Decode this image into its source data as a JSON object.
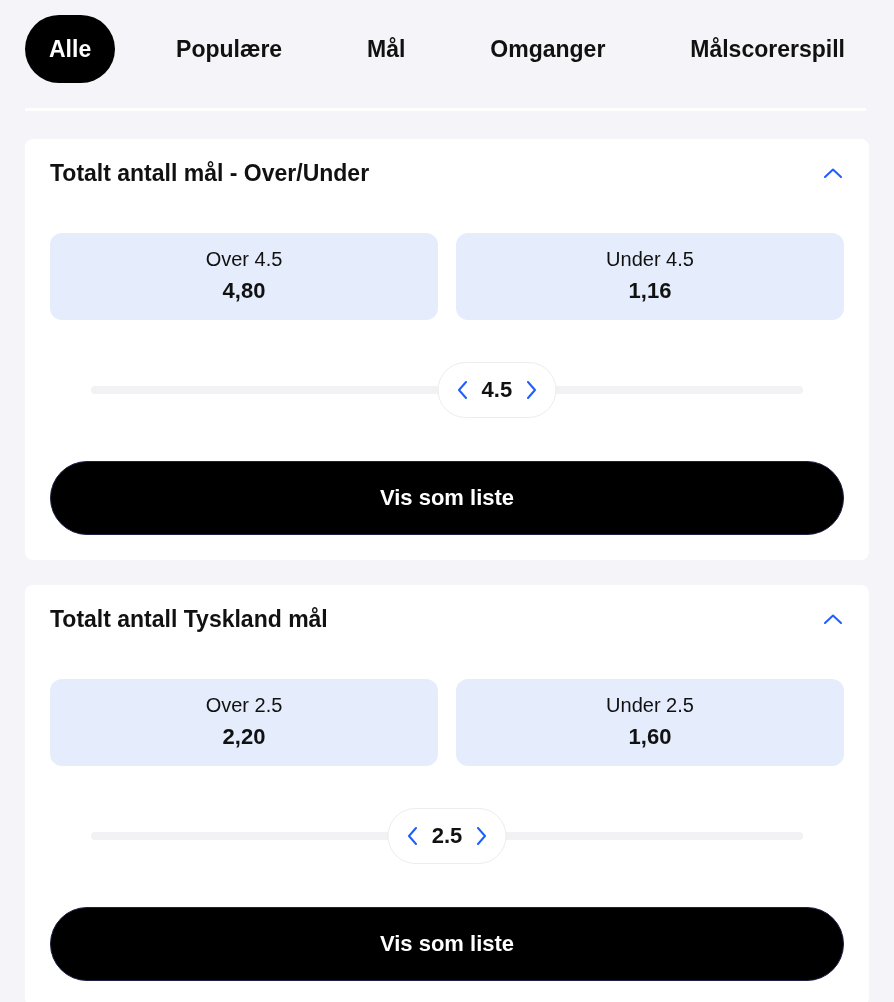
{
  "tabs": [
    {
      "label": "Alle",
      "selected": true
    },
    {
      "label": "Populære",
      "selected": false
    },
    {
      "label": "Mål",
      "selected": false
    },
    {
      "label": "Omganger",
      "selected": false
    },
    {
      "label": "Målscorerspill",
      "selected": false
    }
  ],
  "markets": [
    {
      "title": "Totalt antall mål - Over/Under",
      "expanded": true,
      "outcomes": [
        {
          "label": "Over 4.5",
          "odds": "4,80"
        },
        {
          "label": "Under 4.5",
          "odds": "1,16"
        }
      ],
      "line": {
        "value": "4.5",
        "level": 0.57
      },
      "list_button": "Vis som liste"
    },
    {
      "title": "Totalt antall Tyskland mål",
      "expanded": true,
      "outcomes": [
        {
          "label": "Over 2.5",
          "odds": "2,20"
        },
        {
          "label": "Under 2.5",
          "odds": "1,60"
        }
      ],
      "line": {
        "value": "2.5",
        "level": 0.5
      },
      "list_button": "Vis som liste"
    }
  ]
}
